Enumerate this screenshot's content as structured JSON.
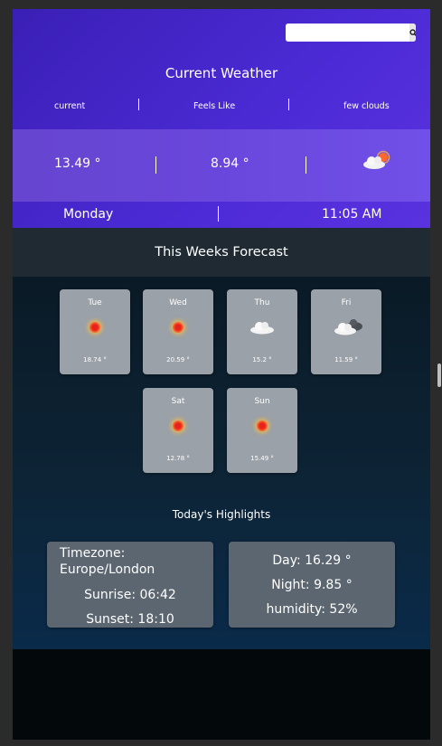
{
  "search": {
    "placeholder": "",
    "value": ""
  },
  "current": {
    "title": "Current Weather",
    "labels": {
      "current": "current",
      "feels_like": "Feels Like",
      "condition": "few clouds"
    },
    "temp": "13.49 °",
    "feels_like_temp": "8.94 °",
    "day": "Monday",
    "time": "11:05 AM"
  },
  "forecast": {
    "title": "This Weeks Forecast",
    "days": [
      {
        "day": "Tue",
        "temp": "18.74 °",
        "icon": "sun-icon"
      },
      {
        "day": "Wed",
        "temp": "20.59 °",
        "icon": "sun-icon"
      },
      {
        "day": "Thu",
        "temp": "15.2 °",
        "icon": "cloud-icon"
      },
      {
        "day": "Fri",
        "temp": "11.59 °",
        "icon": "dark-cloud-icon"
      },
      {
        "day": "Sat",
        "temp": "12.78 °",
        "icon": "sun-icon"
      },
      {
        "day": "Sun",
        "temp": "15.49 °",
        "icon": "sun-icon"
      }
    ]
  },
  "highlights": {
    "title": "Today's Highlights",
    "timezone": "Timezone: Europe/London",
    "sunrise": "Sunrise: 06:42",
    "sunset": "Sunset: 18:10",
    "day_temp": "Day: 16.29 °",
    "night_temp": "Night: 9.85 °",
    "humidity": "humidity: 52%"
  },
  "colors": {
    "header_purple": "#4c2bd6",
    "band_purple": "#6a47dc",
    "card_grey": "#9ba1a8",
    "highlight_card": "#5b6670"
  }
}
